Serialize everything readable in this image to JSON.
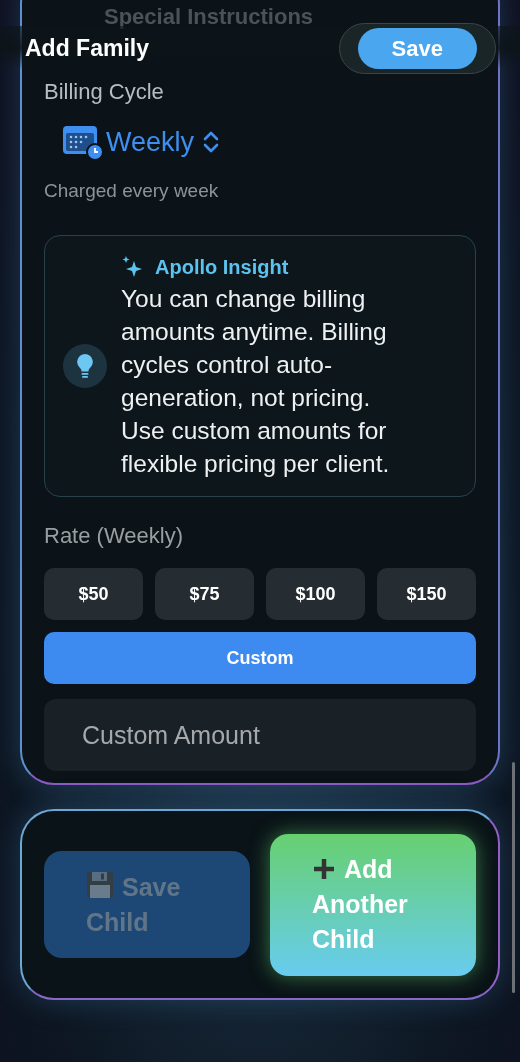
{
  "background_text": "Special Instructions",
  "header": {
    "title": "Add Family",
    "save_button": "Save"
  },
  "billing": {
    "label": "Billing Cycle",
    "cycle": "Weekly",
    "description": "Charged every week"
  },
  "insight": {
    "title": "Apollo Insight",
    "text": "You can change billing amounts anytime. Billing cycles control auto-generation, not pricing. Use custom amounts for flexible pricing per client."
  },
  "rate": {
    "label": "Rate (Weekly)",
    "options": [
      {
        "label": "$50",
        "kind": "preset",
        "selected": false
      },
      {
        "label": "$75",
        "kind": "preset",
        "selected": false
      },
      {
        "label": "$100",
        "kind": "preset",
        "selected": false
      },
      {
        "label": "$150",
        "kind": "preset",
        "selected": false
      },
      {
        "label": "Custom",
        "kind": "custom",
        "selected": true
      }
    ],
    "custom_amount": {
      "placeholder": "Custom Amount"
    }
  },
  "actions": [
    {
      "label": "Save Child",
      "kind": "save",
      "disabled": true
    },
    {
      "label": "Add Another Child",
      "kind": "add",
      "disabled": false
    }
  ]
}
